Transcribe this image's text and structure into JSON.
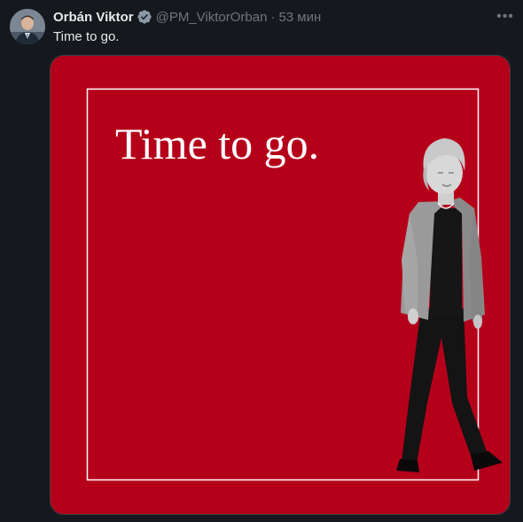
{
  "author": {
    "name": "Orbán Viktor",
    "handle": "@PM_ViktorOrban",
    "time": "53 мин",
    "avatar_icon": "profile-photo-icon",
    "verified_icon": "verified-badge-icon"
  },
  "tweet": {
    "text": "Time to go.",
    "more_icon": "more-icon"
  },
  "media": {
    "headline": "Time to go.",
    "background_color": "#b5001a",
    "frame_color": "#ffffff"
  },
  "colors": {
    "page_bg": "#15181c",
    "text_primary": "#e7e9ea",
    "text_secondary": "#71767b",
    "verified": "#8b98a5"
  }
}
